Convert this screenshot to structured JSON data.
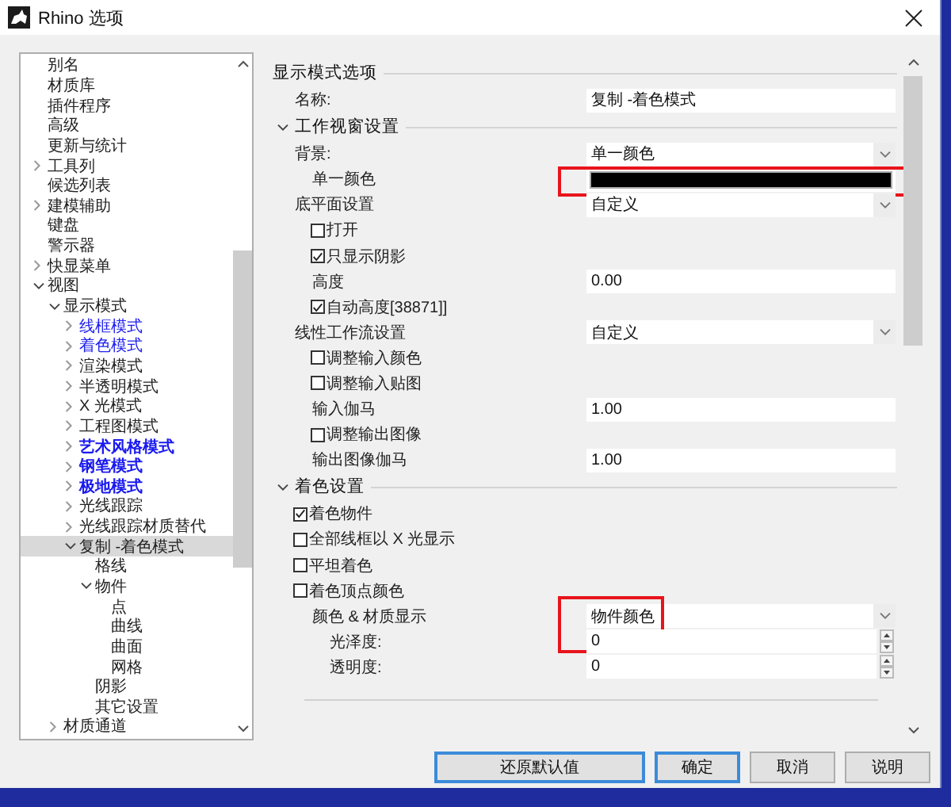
{
  "window": {
    "title": "Rhino 选项"
  },
  "tree": [
    {
      "label": "别名",
      "kind": "plain",
      "selected": false
    },
    {
      "label": "材质库",
      "kind": "plain",
      "selected": false
    },
    {
      "label": "插件程序",
      "kind": "plain",
      "selected": false
    },
    {
      "label": "高级",
      "kind": "plain",
      "selected": false
    },
    {
      "label": "更新与统计",
      "kind": "plain",
      "selected": false
    },
    {
      "label": "工具列",
      "kind": "plain",
      "selected": false,
      "expanded": false
    },
    {
      "label": "候选列表",
      "kind": "plain",
      "selected": false
    },
    {
      "label": "建模辅助",
      "kind": "plain",
      "selected": false,
      "expanded": false
    },
    {
      "label": "键盘",
      "kind": "plain",
      "selected": false
    },
    {
      "label": "警示器",
      "kind": "plain",
      "selected": false
    },
    {
      "label": "快显菜单",
      "kind": "plain",
      "selected": false,
      "expanded": false
    },
    {
      "label": "视图",
      "kind": "plain",
      "selected": false,
      "expanded": true,
      "children": [
        {
          "label": "显示模式",
          "kind": "plain",
          "selected": false,
          "expanded": true,
          "children": [
            {
              "label": "线框模式",
              "kind": "blue",
              "selected": false,
              "expanded": false
            },
            {
              "label": "着色模式",
              "kind": "blue",
              "selected": false,
              "expanded": false
            },
            {
              "label": "渲染模式",
              "kind": "plain",
              "selected": false,
              "expanded": false
            },
            {
              "label": "半透明模式",
              "kind": "plain",
              "selected": false,
              "expanded": false
            },
            {
              "label": "X 光模式",
              "kind": "plain",
              "selected": false,
              "expanded": false
            },
            {
              "label": "工程图模式",
              "kind": "plain",
              "selected": false,
              "expanded": false
            },
            {
              "label": "艺术风格模式",
              "kind": "blue-bold",
              "selected": false,
              "expanded": false
            },
            {
              "label": "钢笔模式",
              "kind": "blue-bold",
              "selected": false,
              "expanded": false
            },
            {
              "label": "极地模式",
              "kind": "blue-bold",
              "selected": false,
              "expanded": false
            },
            {
              "label": "光线跟踪",
              "kind": "plain",
              "selected": false,
              "expanded": false
            },
            {
              "label": "光线跟踪材质替代",
              "kind": "plain",
              "selected": false,
              "expanded": false
            },
            {
              "label": "复制 -着色模式",
              "kind": "plain",
              "selected": true,
              "expanded": true,
              "children": [
                {
                  "label": "格线",
                  "kind": "plain",
                  "selected": false
                },
                {
                  "label": "物件",
                  "kind": "plain",
                  "selected": false,
                  "expanded": true,
                  "children": [
                    {
                      "label": "点",
                      "kind": "plain",
                      "selected": false
                    },
                    {
                      "label": "曲线",
                      "kind": "plain",
                      "selected": false
                    },
                    {
                      "label": "曲面",
                      "kind": "plain",
                      "selected": false
                    },
                    {
                      "label": "网格",
                      "kind": "plain",
                      "selected": false
                    }
                  ]
                },
                {
                  "label": "阴影",
                  "kind": "plain",
                  "selected": false
                },
                {
                  "label": "其它设置",
                  "kind": "plain",
                  "selected": false
                }
              ]
            }
          ]
        },
        {
          "label": "材质通道",
          "kind": "plain",
          "selected": false,
          "expanded": false
        }
      ]
    }
  ],
  "sections": [
    {
      "title": "显示模式选项",
      "rows": [
        {
          "kind": "text",
          "label": "名称:",
          "value": "复制 -着色模式"
        }
      ]
    },
    {
      "title": "工作视窗设置",
      "expanded": true,
      "rows": [
        {
          "kind": "dropdown",
          "label": "背景:",
          "value": "单一颜色",
          "children": [
            {
              "kind": "color",
              "label": "单一颜色",
              "color": "#000000",
              "annotated": true
            }
          ]
        },
        {
          "kind": "dropdown",
          "label": "底平面设置",
          "value": "自定义",
          "children": [
            {
              "kind": "checkbox",
              "label": "打开",
              "checked": false
            },
            {
              "kind": "checkbox",
              "label": "只显示阴影",
              "checked": true
            },
            {
              "kind": "text",
              "label": "高度",
              "value": "0.00"
            },
            {
              "kind": "checkbox",
              "label": "自动高度[38871]]",
              "checked": true
            }
          ]
        },
        {
          "kind": "dropdown",
          "label": "线性工作流设置",
          "value": "自定义",
          "children": [
            {
              "kind": "checkbox",
              "label": "调整输入颜色",
              "checked": false
            },
            {
              "kind": "checkbox",
              "label": "调整输入贴图",
              "checked": false
            },
            {
              "kind": "text",
              "label": "输入伽马",
              "value": "1.00"
            },
            {
              "kind": "checkbox",
              "label": "调整输出图像",
              "checked": false
            },
            {
              "kind": "text",
              "label": "输出图像伽马",
              "value": "1.00"
            }
          ]
        }
      ]
    },
    {
      "title": "着色设置",
      "expanded": true,
      "rows": [
        {
          "kind": "checkbox",
          "label": "着色物件",
          "checked": true
        },
        {
          "kind": "checkbox",
          "label": "全部线框以 X 光显示",
          "checked": false
        },
        {
          "kind": "checkbox",
          "label": "平坦着色",
          "checked": false
        },
        {
          "kind": "checkbox",
          "label": "着色顶点颜色",
          "checked": false,
          "children": [
            {
              "kind": "dropdown",
              "label": "颜色 & 材质显示",
              "value": "物件颜色",
              "annotated": true,
              "children": [
                {
                  "kind": "spinner",
                  "label": "光泽度:",
                  "value": "0"
                },
                {
                  "kind": "spinner",
                  "label": "透明度:",
                  "value": "0"
                }
              ]
            }
          ]
        }
      ]
    }
  ],
  "buttons": [
    {
      "label": "还原默认值",
      "highlighted": true
    },
    {
      "label": "确定",
      "highlighted": true
    },
    {
      "label": "取消",
      "highlighted": false
    },
    {
      "label": "说明",
      "highlighted": false
    }
  ]
}
